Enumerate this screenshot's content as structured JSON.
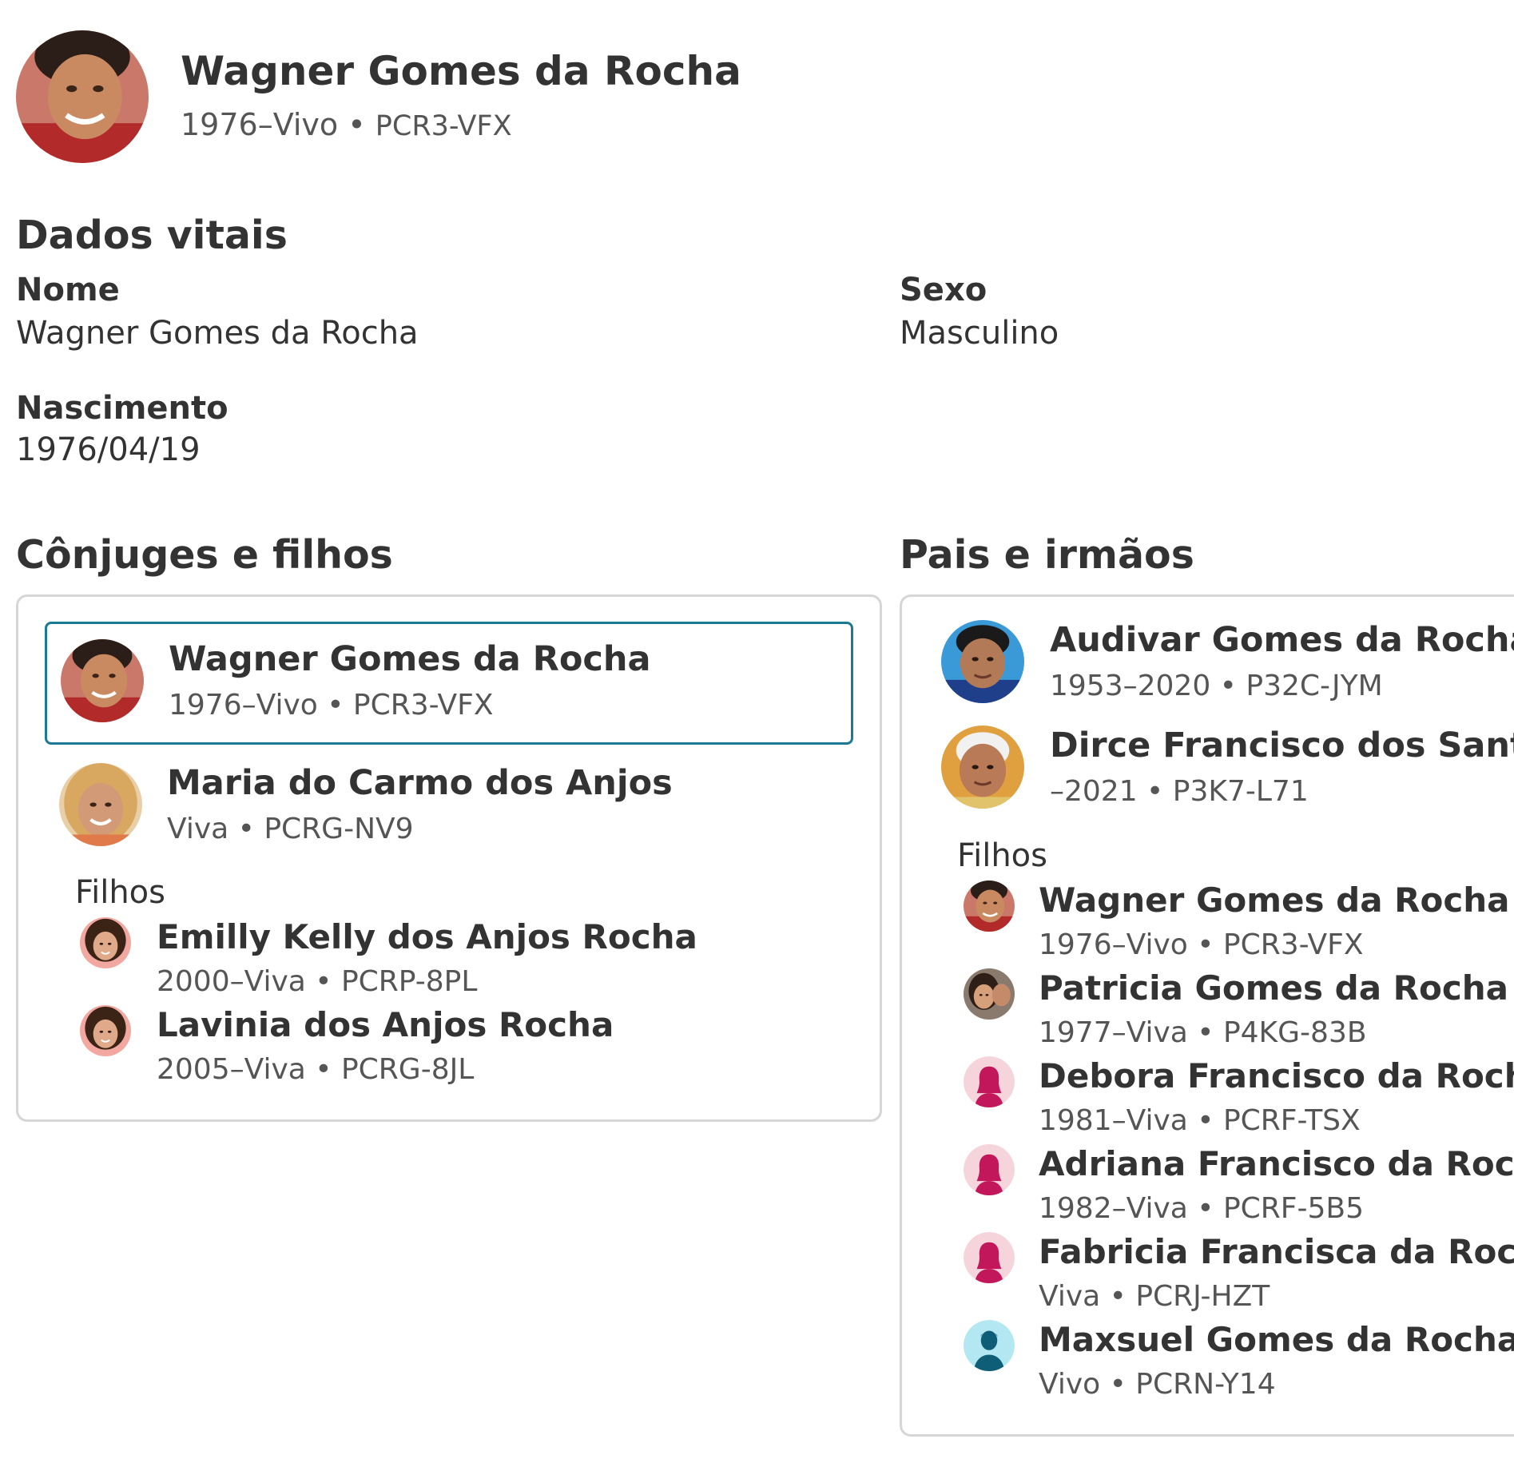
{
  "header": {
    "name": "Wagner Gomes da Rocha",
    "lifespan": "1976–Vivo",
    "sep": "•",
    "pid": "PCR3-VFX"
  },
  "vitals": {
    "title": "Dados vitais",
    "name_label": "Nome",
    "name_value": "Wagner Gomes da Rocha",
    "sex_label": "Sexo",
    "sex_value": "Masculino",
    "birth_label": "Nascimento",
    "birth_value": "1976/04/19"
  },
  "spouses": {
    "title": "Cônjuges e filhos",
    "couple": [
      {
        "name": "Wagner Gomes da Rocha",
        "meta": "1976–Vivo • PCR3-VFX",
        "selected": true
      },
      {
        "name": "Maria do Carmo dos Anjos",
        "meta": "Viva • PCRG-NV9"
      }
    ],
    "children_label": "Filhos",
    "children": [
      {
        "name": "Emilly Kelly dos Anjos Rocha",
        "meta": "2000–Viva • PCRP-8PL"
      },
      {
        "name": "Lavinia dos Anjos Rocha",
        "meta": "2005–Viva • PCRG-8JL"
      }
    ]
  },
  "parents": {
    "title": "Pais e irmãos",
    "couple": [
      {
        "name": "Audivar Gomes da Rocha",
        "meta": "1953–2020 • P32C-JYM"
      },
      {
        "name": "Dirce Francisco dos Santos",
        "meta": "–2021 • P3K7-L71"
      }
    ],
    "children_label": "Filhos",
    "children": [
      {
        "name": "Wagner Gomes da Rocha",
        "meta": "1976–Vivo • PCR3-VFX",
        "avatar": "photo"
      },
      {
        "name": "Patricia Gomes da Rocha",
        "meta": "1977–Viva • P4KG-83B",
        "avatar": "photo"
      },
      {
        "name": "Debora Francisco da Rocha",
        "meta": "1981–Viva • PCRF-TSX",
        "avatar": "female-placeholder-icon"
      },
      {
        "name": "Adriana Francisco da Rocha",
        "meta": "1982–Viva • PCRF-5B5",
        "avatar": "female-placeholder-icon"
      },
      {
        "name": "Fabricia Francisca da Rocha",
        "meta": "Viva • PCRJ-HZT",
        "avatar": "female-placeholder-icon"
      },
      {
        "name": "Maxsuel Gomes da Rocha",
        "meta": "Vivo • PCRN-Y14",
        "avatar": "male-placeholder-icon"
      }
    ]
  },
  "colors": {
    "selected_border": "#1d7a94",
    "card_border": "#d6d6d6",
    "female_placeholder_bg": "#f6d4dc",
    "female_placeholder_fg": "#c2185b",
    "male_placeholder_bg": "#b3e7f2",
    "male_placeholder_fg": "#0f5e78"
  }
}
